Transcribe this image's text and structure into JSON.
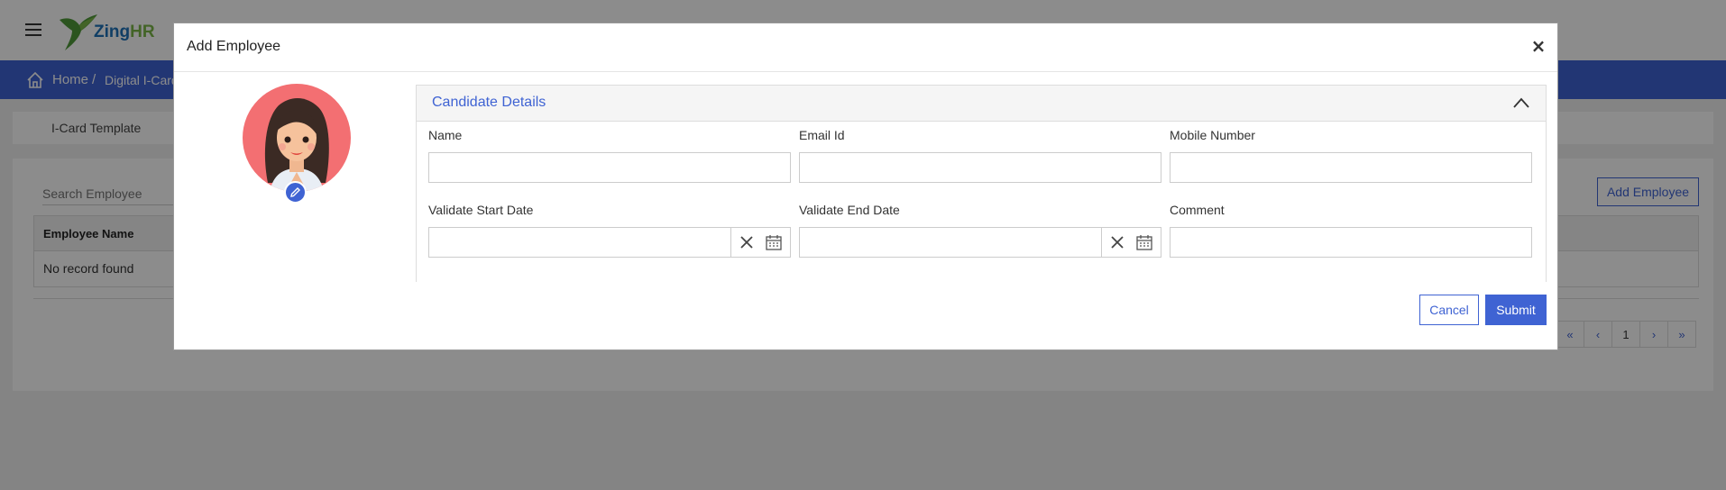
{
  "app": {
    "logo_text_prefix": "Zing",
    "logo_text_suffix": "HR"
  },
  "breadcrumb": {
    "home": "Home",
    "separator": "/",
    "current": "Digital I-Card"
  },
  "tabs": {
    "icard_template": "I-Card Template"
  },
  "employee_list": {
    "search_placeholder": "Search Employee",
    "add_button": "Add Employee",
    "column_employee_name": "Employee Name",
    "empty_message": "No record found",
    "pager": {
      "first": "«",
      "prev": "‹",
      "current_page": "1",
      "next": "›",
      "last": "»"
    }
  },
  "modal": {
    "title": "Add Employee",
    "close_label": "×",
    "section_title": "Candidate Details",
    "fields": {
      "name": {
        "label": "Name",
        "value": ""
      },
      "email": {
        "label": "Email Id",
        "value": ""
      },
      "mobile": {
        "label": "Mobile Number",
        "value": ""
      },
      "start_date": {
        "label": "Validate Start Date",
        "value": ""
      },
      "end_date": {
        "label": "Validate End Date",
        "value": ""
      },
      "comment": {
        "label": "Comment",
        "value": ""
      }
    },
    "cancel_label": "Cancel",
    "submit_label": "Submit"
  },
  "colors": {
    "primary": "#3f63d3",
    "avatar_bg": "#f36f72",
    "logo_blue": "#1e72b8",
    "logo_green": "#7ab648"
  }
}
